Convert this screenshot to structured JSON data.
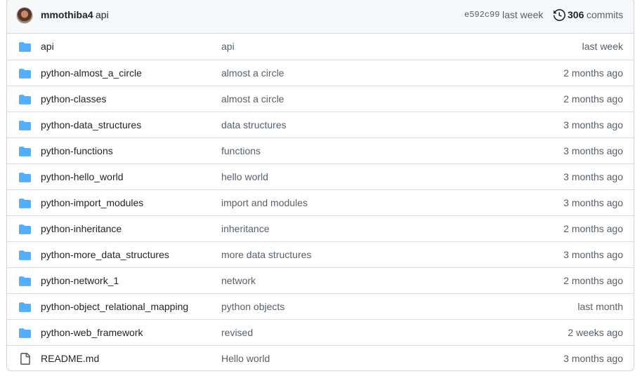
{
  "latest_commit": {
    "author": "mmothiba4",
    "message": "api",
    "sha": "e592c99",
    "time": "last week",
    "commits_count": "306",
    "commits_label": "commits"
  },
  "files": [
    {
      "type": "folder",
      "name": "api",
      "message": "api",
      "age": "last week"
    },
    {
      "type": "folder",
      "name": "python-almost_a_circle",
      "message": "almost a circle",
      "age": "2 months ago"
    },
    {
      "type": "folder",
      "name": "python-classes",
      "message": "almost a circle",
      "age": "2 months ago"
    },
    {
      "type": "folder",
      "name": "python-data_structures",
      "message": "data structures",
      "age": "3 months ago"
    },
    {
      "type": "folder",
      "name": "python-functions",
      "message": "functions",
      "age": "3 months ago"
    },
    {
      "type": "folder",
      "name": "python-hello_world",
      "message": "hello world",
      "age": "3 months ago"
    },
    {
      "type": "folder",
      "name": "python-import_modules",
      "message": "import and modules",
      "age": "3 months ago"
    },
    {
      "type": "folder",
      "name": "python-inheritance",
      "message": "inheritance",
      "age": "2 months ago"
    },
    {
      "type": "folder",
      "name": "python-more_data_structures",
      "message": "more data structures",
      "age": "3 months ago"
    },
    {
      "type": "folder",
      "name": "python-network_1",
      "message": "network",
      "age": "2 months ago"
    },
    {
      "type": "folder",
      "name": "python-object_relational_mapping",
      "message": "python objects",
      "age": "last month"
    },
    {
      "type": "folder",
      "name": "python-web_framework",
      "message": "revised",
      "age": "2 weeks ago"
    },
    {
      "type": "file",
      "name": "README.md",
      "message": "Hello world",
      "age": "3 months ago"
    }
  ],
  "colors": {
    "folder_icon": "#54aeff",
    "file_icon": "#57606a",
    "border": "#d0d7de",
    "header_bg": "#f6f8fa"
  }
}
